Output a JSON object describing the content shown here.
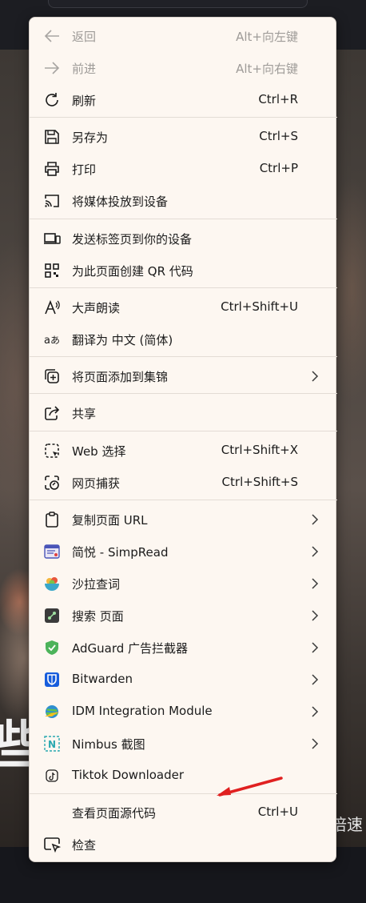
{
  "menu": {
    "back": {
      "label": "返回",
      "shortcut": "Alt+向左键"
    },
    "forward": {
      "label": "前进",
      "shortcut": "Alt+向右键"
    },
    "refresh": {
      "label": "刷新",
      "shortcut": "Ctrl+R"
    },
    "save_as": {
      "label": "另存为",
      "shortcut": "Ctrl+S"
    },
    "print": {
      "label": "打印",
      "shortcut": "Ctrl+P"
    },
    "cast": {
      "label": "将媒体投放到设备"
    },
    "send_tab": {
      "label": "发送标签页到你的设备"
    },
    "qr_code": {
      "label": "为此页面创建 QR 代码"
    },
    "read_aloud": {
      "label": "大声朗读",
      "shortcut": "Ctrl+Shift+U"
    },
    "translate": {
      "label": "翻译为 中文 (简体)"
    },
    "add_collection": {
      "label": "将页面添加到集锦"
    },
    "share": {
      "label": "共享"
    },
    "web_select": {
      "label": "Web 选择",
      "shortcut": "Ctrl+Shift+X"
    },
    "web_capture": {
      "label": "网页捕获",
      "shortcut": "Ctrl+Shift+S"
    },
    "copy_url": {
      "label": "复制页面 URL"
    },
    "simpread": {
      "label": "简悦 - SimpRead"
    },
    "salad": {
      "label": "沙拉查词"
    },
    "search_page": {
      "label": "搜索 页面"
    },
    "adguard": {
      "label": "AdGuard 广告拦截器"
    },
    "bitwarden": {
      "label": "Bitwarden"
    },
    "idm": {
      "label": "IDM Integration Module"
    },
    "nimbus": {
      "label": "Nimbus 截图"
    },
    "tiktok": {
      "label": "Tiktok Downloader"
    },
    "view_source": {
      "label": "查看页面源代码",
      "shortcut": "Ctrl+U"
    },
    "inspect": {
      "label": "检查"
    }
  },
  "background": {
    "video_text_left": "些",
    "video_text_right": "倍速"
  },
  "colors": {
    "menu_bg": "#fdf7f1",
    "annotation_arrow": "#e02020",
    "adguard_green": "#4cb35a",
    "bitwarden_blue": "#175ddc"
  }
}
